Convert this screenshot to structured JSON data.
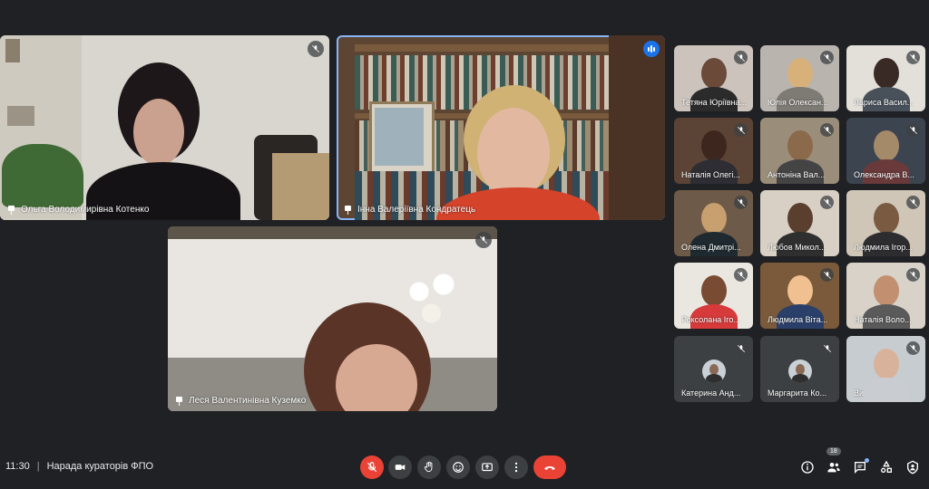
{
  "main_tiles": [
    {
      "name": "Ольга Володимирівна Котенко",
      "pinned": true,
      "muted": true
    },
    {
      "name": "Інна Валеріївна Кондратець",
      "pinned": true,
      "speaking": true
    },
    {
      "name": "Леся Валентинівна Куземко",
      "pinned": true,
      "muted": true
    }
  ],
  "grid_tiles": [
    {
      "name": "Тетяна Юріївна..."
    },
    {
      "name": "Юлія Олексан..."
    },
    {
      "name": "Лариса Васил..."
    },
    {
      "name": "Наталія Олегі..."
    },
    {
      "name": "Антоніна Вал..."
    },
    {
      "name": "Олександра В..."
    },
    {
      "name": "Олена Дмитрі..."
    },
    {
      "name": "Любов Микол..."
    },
    {
      "name": "Людмила Ігор..."
    },
    {
      "name": "Роксолана Іго..."
    },
    {
      "name": "Людмила Віта..."
    },
    {
      "name": "Наталія Воло..."
    },
    {
      "name": "Катерина Анд..."
    },
    {
      "name": "Маргарита Ко..."
    },
    {
      "name": "Ви"
    }
  ],
  "meeting": {
    "time": "11:30",
    "separator": "|",
    "title": "Нарада кураторів ФПО"
  },
  "people_count": "18",
  "colors": {
    "background": "#202124",
    "tile": "#3c4043",
    "end_call": "#ea4335",
    "accent": "#8ab4f8"
  },
  "icons": {
    "controls": [
      "mic-off-icon",
      "camera-icon",
      "raise-hand-icon",
      "emoji-icon",
      "present-icon",
      "more-icon",
      "end-call-icon"
    ],
    "right": [
      "info-icon",
      "people-icon",
      "chat-icon",
      "activities-icon",
      "host-controls-icon"
    ]
  }
}
